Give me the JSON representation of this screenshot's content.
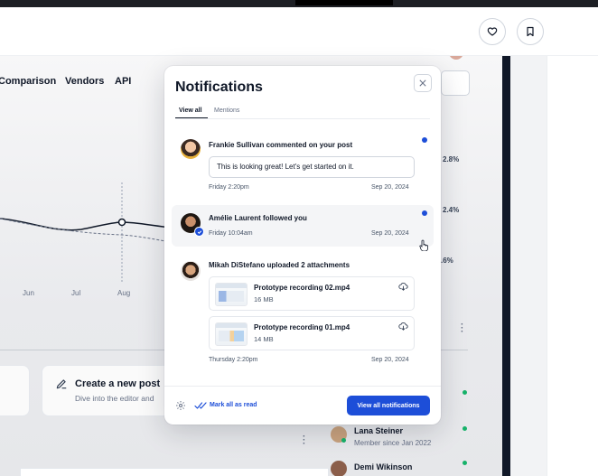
{
  "header": {
    "favorite_icon": "heart-icon",
    "bookmark_icon": "bookmark-icon"
  },
  "app": {
    "nav": [
      "Comparison",
      "Vendors",
      "API"
    ],
    "x_axis": [
      "Jun",
      "Jul",
      "Aug"
    ],
    "stats": [
      "2.8%",
      "2.4%",
      ".6%"
    ],
    "create_card": {
      "title": "Create a new post",
      "subtitle": "Dive into the editor and"
    },
    "members": [
      {
        "name": "Lana Steiner",
        "subtitle": "Member since Jan 2022"
      },
      {
        "name": "Demi Wikinson",
        "subtitle": ""
      }
    ]
  },
  "modal": {
    "title": "Notifications",
    "tabs": [
      "View all",
      "Mentions"
    ],
    "notifications": [
      {
        "text": "Frankie Sullivan commented on your post",
        "message": "This is looking great! Let's get started on it.",
        "time": "Friday 2:20pm",
        "date": "Sep 20, 2024",
        "unread": true
      },
      {
        "text": "Amélie Laurent followed you",
        "time": "Friday 10:04am",
        "date": "Sep 20, 2024",
        "unread": true
      },
      {
        "text": "Mikah DiStefano uploaded 2 attachments",
        "time": "Thursday 2:20pm",
        "date": "Sep 20, 2024",
        "unread": false,
        "files": [
          {
            "name": "Prototype recording 02.mp4",
            "size": "16 MB"
          },
          {
            "name": "Prototype recording 01.mp4",
            "size": "14 MB"
          }
        ]
      }
    ],
    "footer": {
      "mark_read": "Mark all as read",
      "view_all": "View all notifications"
    }
  },
  "colors": {
    "accent": "#1d4ed8",
    "online": "#17b26a",
    "text": "#101828"
  }
}
